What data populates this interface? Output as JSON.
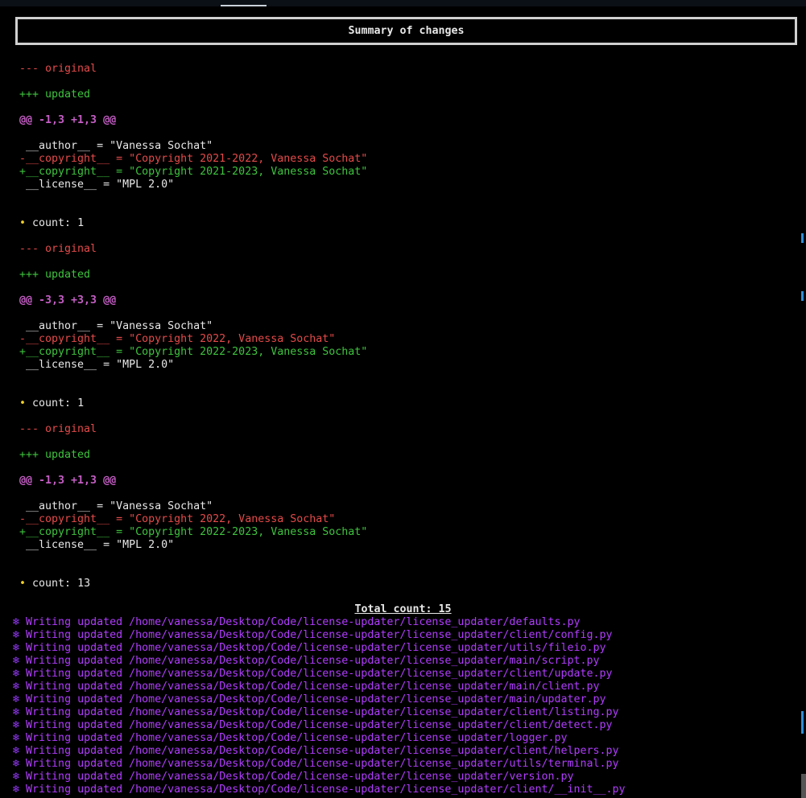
{
  "header": {
    "title": "Summary of changes"
  },
  "diffs": [
    {
      "orig": "--- original",
      "upd": "+++ updated",
      "hunk": "@@ -1,3 +1,3 @@",
      "ctx1": " __author__ = \"Vanessa Sochat\"",
      "del": "-__copyright__ = \"Copyright 2021-2022, Vanessa Sochat\"",
      "add": "+__copyright__ = \"Copyright 2021-2023, Vanessa Sochat\"",
      "ctx2": " __license__ = \"MPL 2.0\"",
      "count_bullet": "•",
      "count": "count: 1"
    },
    {
      "orig": "--- original",
      "upd": "+++ updated",
      "hunk": "@@ -3,3 +3,3 @@",
      "ctx1": " __author__ = \"Vanessa Sochat\"",
      "del": "-__copyright__ = \"Copyright 2022, Vanessa Sochat\"",
      "add": "+__copyright__ = \"Copyright 2022-2023, Vanessa Sochat\"",
      "ctx2": " __license__ = \"MPL 2.0\"",
      "count_bullet": "•",
      "count": "count: 1"
    },
    {
      "orig": "--- original",
      "upd": "+++ updated",
      "hunk": "@@ -1,3 +1,3 @@",
      "ctx1": " __author__ = \"Vanessa Sochat\"",
      "del": "-__copyright__ = \"Copyright 2022, Vanessa Sochat\"",
      "add": "+__copyright__ = \"Copyright 2022-2023, Vanessa Sochat\"",
      "ctx2": " __license__ = \"MPL 2.0\"",
      "count_bullet": "•",
      "count": "count: 13"
    }
  ],
  "total": "Total count: 15",
  "writes": {
    "prefix": "❄",
    "lines": [
      "Writing updated /home/vanessa/Desktop/Code/license-updater/license_updater/defaults.py",
      "Writing updated /home/vanessa/Desktop/Code/license-updater/license_updater/client/config.py",
      "Writing updated /home/vanessa/Desktop/Code/license-updater/license_updater/utils/fileio.py",
      "Writing updated /home/vanessa/Desktop/Code/license-updater/license_updater/main/script.py",
      "Writing updated /home/vanessa/Desktop/Code/license-updater/license_updater/client/update.py",
      "Writing updated /home/vanessa/Desktop/Code/license-updater/license_updater/main/client.py",
      "Writing updated /home/vanessa/Desktop/Code/license-updater/license_updater/main/updater.py",
      "Writing updated /home/vanessa/Desktop/Code/license-updater/license_updater/client/listing.py",
      "Writing updated /home/vanessa/Desktop/Code/license-updater/license_updater/client/detect.py",
      "Writing updated /home/vanessa/Desktop/Code/license-updater/license_updater/logger.py",
      "Writing updated /home/vanessa/Desktop/Code/license-updater/license_updater/client/helpers.py",
      "Writing updated /home/vanessa/Desktop/Code/license-updater/license_updater/utils/terminal.py",
      "Writing updated /home/vanessa/Desktop/Code/license-updater/license_updater/version.py",
      "Writing updated /home/vanessa/Desktop/Code/license-updater/license_updater/client/__init__.py"
    ]
  },
  "colors": {
    "background": "#000000",
    "deletion": "#e54a4a",
    "addition": "#3ec33e",
    "hunk": "#c45ec4",
    "bullet": "#f0d028",
    "writing": "#b13cff"
  }
}
